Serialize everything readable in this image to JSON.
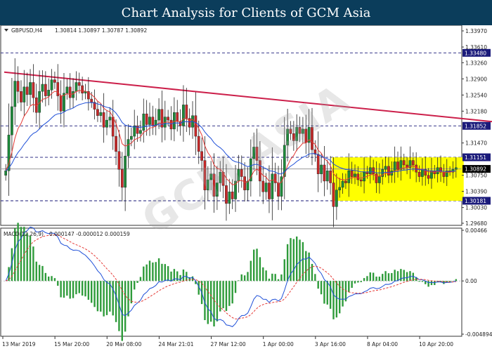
{
  "banner_title": "Chart Analysis for Clients of GCM Asia",
  "watermark_text": "GCM ASIA",
  "colors": {
    "banner": "#0b3d5b",
    "bull": "#1d8a3a",
    "bear": "#c62828",
    "ema_fast": "#e53935",
    "ema_slow": "#1e4fd8",
    "trendline": "#cc1f4a",
    "zone": "#ffff00",
    "level": "#1a1a7a",
    "macd_line": "#1e4fd8",
    "signal_line": "#e53935",
    "histogram": "#2e9b3a"
  },
  "chart_data": [
    {
      "type": "candlestick",
      "header": {
        "symbol": "GBPUSD,H4",
        "ohlc": "1.30814 1.30897 1.30787 1.30892"
      },
      "ylim": [
        1.2968,
        1.3397
      ],
      "y_ticks": [
        "1.33970",
        "1.33610",
        "1.33260",
        "1.32900",
        "1.32540",
        "1.32180",
        "1.31470",
        "1.30750",
        "1.30390",
        "1.30030",
        "1.29680"
      ],
      "levels": [
        {
          "label": "1.33480",
          "value": 1.3348
        },
        {
          "label": "1.31852",
          "value": 1.31852
        },
        {
          "label": "1.31151",
          "value": 1.31151
        },
        {
          "label": "1.30181",
          "value": 1.30181
        }
      ],
      "current_price": {
        "label": "1.30892",
        "value": 1.30892
      },
      "x_labels": [
        "13 Mar 2019",
        "15 Mar 20:00",
        "20 Mar 08:00",
        "24 Mar 21:01",
        "27 Mar 12:00",
        "1 Apr 00:00",
        "3 Apr 16:00",
        "8 Apr 04:00",
        "10 Apr 20:00"
      ],
      "trendline": {
        "x_start": 0,
        "y_start": 1.3305,
        "x_end": 163,
        "y_end": 1.3192
      },
      "zone": {
        "x_start": 107,
        "x_end": 150,
        "y_top": 1.3115,
        "y_bottom": 1.3018
      },
      "close": [
        1.3085,
        1.3165,
        1.3228,
        1.3285,
        1.3262,
        1.3238,
        1.3272,
        1.3255,
        1.3282,
        1.3248,
        1.3215,
        1.3262,
        1.3278,
        1.3252,
        1.3265,
        1.3288,
        1.3282,
        1.3252,
        1.3218,
        1.3258,
        1.3272,
        1.3248,
        1.3262,
        1.3282,
        1.3275,
        1.3258,
        1.3262,
        1.3245,
        1.3238,
        1.3222,
        1.3208,
        1.3215,
        1.3182,
        1.3198,
        1.3205,
        1.3162,
        1.3128,
        1.3088,
        1.3048,
        1.3118,
        1.3155,
        1.3162,
        1.3185,
        1.3168,
        1.3175,
        1.3212,
        1.3188,
        1.3205,
        1.3185,
        1.3198,
        1.3222,
        1.3182,
        1.3205,
        1.3198,
        1.3178,
        1.3215,
        1.3195,
        1.3185,
        1.3232,
        1.3202,
        1.3182,
        1.3208,
        1.3162,
        1.3128,
        1.3108,
        1.3042,
        1.3065,
        1.3078,
        1.3028,
        1.3058,
        1.3082,
        1.3052,
        1.3012,
        1.3038,
        1.3022,
        1.3062,
        1.3088,
        1.3072,
        1.3042,
        1.3062,
        1.3112,
        1.3138,
        1.3108,
        1.3062,
        1.3038,
        1.3058,
        1.3022,
        1.3078,
        1.3058,
        1.3028,
        1.3072,
        1.3142,
        1.3178,
        1.3168,
        1.3152,
        1.3182,
        1.3168,
        1.3178,
        1.3148,
        1.3182,
        1.3132,
        1.3122,
        1.3078,
        1.3098,
        1.3062,
        1.3085,
        1.3058,
        1.3005,
        1.3042,
        1.3048,
        1.3062,
        1.3058,
        1.3085,
        1.3072,
        1.3078,
        1.3065,
        1.3062,
        1.3082,
        1.3078,
        1.3092,
        1.3078,
        1.3058,
        1.3072,
        1.3088,
        1.3095,
        1.3075,
        1.3085,
        1.3105,
        1.3088,
        1.3108,
        1.3098,
        1.3092,
        1.3108,
        1.3098,
        1.3082,
        1.3072,
        1.3088,
        1.3075,
        1.3068,
        1.3085,
        1.3078,
        1.3092,
        1.3082,
        1.3072,
        1.3085,
        1.3082,
        1.3088,
        1.3092
      ],
      "series": [
        {
          "name": "EMA fast"
        },
        {
          "name": "EMA slow"
        }
      ]
    },
    {
      "type": "line+bar",
      "header": {
        "label": "MACD(12,26,9)",
        "values": "0.000147 -0.000012 0.000159"
      },
      "ylim": [
        -0.004894,
        0.004662
      ],
      "y_ticks": [
        "0.00466",
        "0.00",
        "-0.004894"
      ],
      "series": [
        {
          "name": "MACD"
        },
        {
          "name": "Signal"
        },
        {
          "name": "Histogram"
        }
      ]
    }
  ]
}
